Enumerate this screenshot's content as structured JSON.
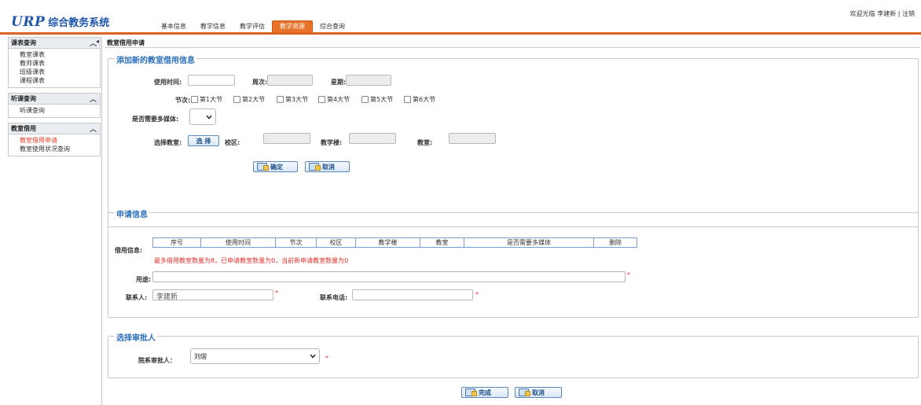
{
  "header": {
    "logo_urp": "URP",
    "logo_sys": "综合教务系统",
    "welcome": "欢迎光临 李建新 | 注销"
  },
  "topnav": [
    {
      "label": "基本信息"
    },
    {
      "label": "教学信息"
    },
    {
      "label": "教学评估"
    },
    {
      "label": "教学资源"
    },
    {
      "label": "综合查询"
    }
  ],
  "sidebar": {
    "groups": [
      {
        "title": "课表查询",
        "items": [
          "教室课表",
          "教师课表",
          "班级课表",
          "课程课表"
        ]
      },
      {
        "title": "听课查询",
        "items": [
          "听课查询"
        ]
      },
      {
        "title": "教室借用",
        "items": [
          "教室借用申请",
          "教室使用状况查询"
        ]
      }
    ]
  },
  "page_title": "教室借用申请",
  "add_section": {
    "legend": "添加新的教室借用信息",
    "use_time_label": "使用时间:",
    "week_label": "周次:",
    "weekday_label": "星期:",
    "period_label": "节次:",
    "periods": [
      "第1大节",
      "第2大节",
      "第3大节",
      "第4大节",
      "第5大节",
      "第6大节"
    ],
    "multimedia_label": "是否需要多媒体:",
    "select_room_label": "选择教室:",
    "select_btn": "选 择",
    "campus_label": "校区:",
    "building_label": "教学楼:",
    "room_label": "教室:",
    "ok_btn": "确定",
    "cancel_btn": "取消"
  },
  "apply_section": {
    "legend": "申请信息",
    "borrow_info_label": "借用信息:",
    "columns": [
      "序号",
      "使用时间",
      "节次",
      "校区",
      "教学楼",
      "教室",
      "是否需要多媒体",
      "删除"
    ],
    "note": "最多借用教室数量为8，已申请教室数量为0，当前新申请教室数量为0",
    "purpose_label": "用途:",
    "contact_label": "联系人:",
    "contact_value": "李建新",
    "phone_label": "联系电话:",
    "required_mark": "*"
  },
  "approver_section": {
    "legend": "选择审批人",
    "approver_label": "院系审批人：",
    "approver_value": "刘熠"
  },
  "footer": {
    "finish_btn": "完成",
    "cancel_btn": "取消"
  }
}
